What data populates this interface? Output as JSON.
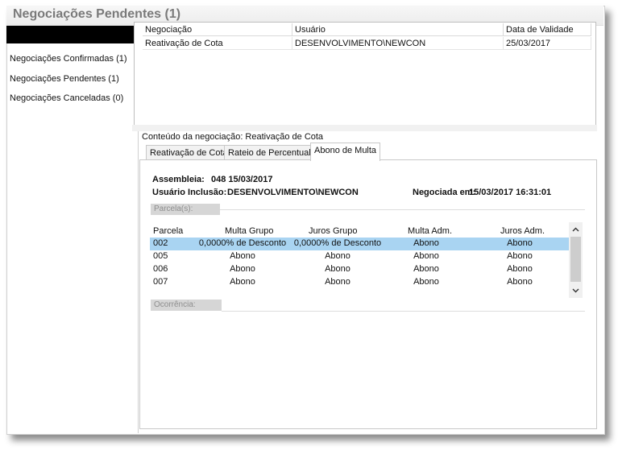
{
  "window": {
    "title": "Negociações Pendentes (1)"
  },
  "sidebar": {
    "items": [
      {
        "label": "Negociações Confirmadas (1)"
      },
      {
        "label": "Negociações Pendentes (1)"
      },
      {
        "label": "Negociações Canceladas (0)"
      }
    ]
  },
  "negotiations_grid": {
    "columns": [
      "Negociação",
      "Usuário",
      "Data de Validade"
    ],
    "rows": [
      {
        "negociacao": "Reativação de Cota",
        "usuario": "DESENVOLVIMENTO\\NEWCON",
        "data": "25/03/2017"
      }
    ]
  },
  "content": {
    "label": "Conteúdo da negociação: Reativação de Cota",
    "tabs": [
      {
        "label": "Reativação de Cota"
      },
      {
        "label": "Rateio de Percentual"
      },
      {
        "label": "Abono de Multa",
        "active": true
      }
    ]
  },
  "details": {
    "assembleia_label": "Assembleia:",
    "assembleia_value": "048  15/03/2017",
    "usuario_label": "Usuário Inclusão:",
    "usuario_value": "DESENVOLVIMENTO\\NEWCON",
    "negociada_label": "Negociada em:",
    "negociada_value": "15/03/2017 16:31:01"
  },
  "parcelas": {
    "group_label": "Parcela(s):",
    "columns": [
      "Parcela",
      "Multa Grupo",
      "Juros Grupo",
      "Multa Adm.",
      "Juros Adm."
    ],
    "rows": [
      {
        "parcela": "002",
        "multa_grupo": "0,0000% de Desconto",
        "juros_grupo": "0,0000% de Desconto",
        "multa_adm": "Abono",
        "juros_adm": "Abono"
      },
      {
        "parcela": "005",
        "multa_grupo": "Abono",
        "juros_grupo": "Abono",
        "multa_adm": "Abono",
        "juros_adm": "Abono"
      },
      {
        "parcela": "006",
        "multa_grupo": "Abono",
        "juros_grupo": "Abono",
        "multa_adm": "Abono",
        "juros_adm": "Abono"
      },
      {
        "parcela": "007",
        "multa_grupo": "Abono",
        "juros_grupo": "Abono",
        "multa_adm": "Abono",
        "juros_adm": "Abono"
      }
    ]
  },
  "ocorrencia": {
    "group_label": "Ocorrência:"
  },
  "icons": {
    "scroll_up": "chevron-up-icon",
    "scroll_down": "chevron-down-icon"
  },
  "colors": {
    "selection": "#a9d4f2",
    "title": "#7a7a7a"
  }
}
